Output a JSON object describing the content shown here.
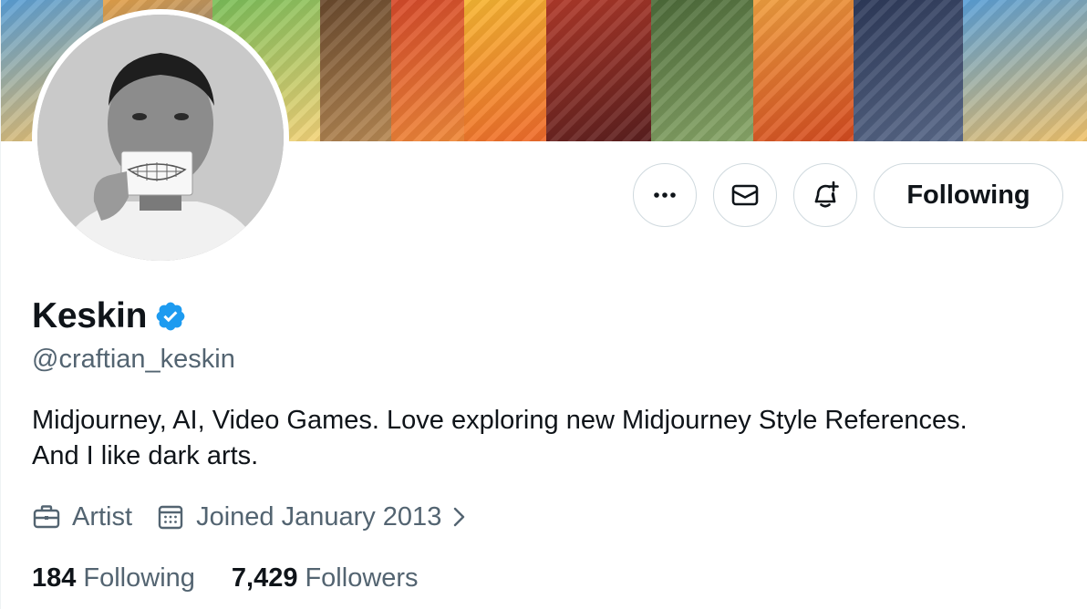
{
  "banner": {
    "panel_colors": [
      [
        "#5aa0d8",
        "#f2c36b"
      ],
      [
        "#e7a34a",
        "#3b6aa8"
      ],
      [
        "#7bbf5a",
        "#f4d37a"
      ],
      [
        "#6a4a2e",
        "#b88a55"
      ],
      [
        "#d64a2b",
        "#f08a3a"
      ],
      [
        "#f7b733",
        "#ef6a2b"
      ],
      [
        "#b23a2a",
        "#5a1f1f"
      ],
      [
        "#4d6b3a",
        "#8aa86a"
      ],
      [
        "#f0a040",
        "#d44a20"
      ],
      [
        "#2e3a5a",
        "#5a6a8a"
      ]
    ]
  },
  "profile": {
    "display_name": "Keskin",
    "handle": "@craftian_keskin",
    "verified": true,
    "bio_line1": "Midjourney, AI, Video Games. Love exploring new Midjourney Style References.",
    "bio_line2": "And I like dark arts.",
    "profession": "Artist",
    "joined": "Joined January 2013",
    "following_count": "184",
    "following_label": "Following",
    "followers_count": "7,429",
    "followers_label": "Followers"
  },
  "actions": {
    "more_icon": "more-horizontal-icon",
    "message_icon": "envelope-icon",
    "notify_icon": "bell-plus-icon",
    "follow_button_label": "Following"
  },
  "colors": {
    "accent_verified": "#1d9bf0",
    "text_primary": "#0f1419",
    "text_secondary": "#536471",
    "border": "#cfd9de"
  }
}
